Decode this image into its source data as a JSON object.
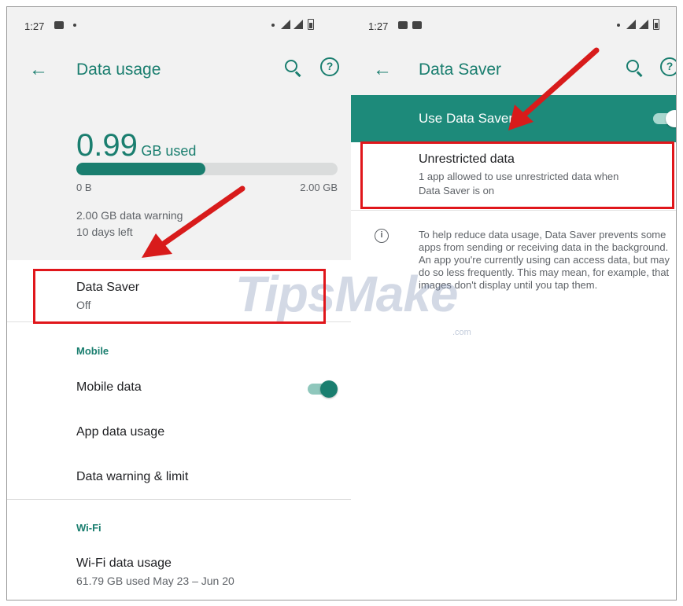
{
  "left": {
    "status": {
      "time": "1:27"
    },
    "appbar": {
      "title": "Data usage",
      "back_icon": "arrow-left-icon",
      "search_icon": "search-icon",
      "help_icon": "help-icon",
      "help_glyph": "?"
    },
    "summary": {
      "used_value": "0.99",
      "used_unit": "GB used",
      "progress_fraction": 0.495,
      "range_min": "0 B",
      "range_max": "2.00 GB",
      "warning": "2.00 GB data warning",
      "days_left": "10 days left"
    },
    "data_saver": {
      "title": "Data Saver",
      "status": "Off"
    },
    "mobile": {
      "section": "Mobile",
      "mobile_data": {
        "label": "Mobile data",
        "enabled": true
      },
      "app_data_usage": "App data usage",
      "warning_limit": "Data warning & limit"
    },
    "wifi": {
      "section": "Wi-Fi",
      "usage_title": "Wi-Fi data usage",
      "usage_detail": "61.79 GB used May 23 – Jun 20"
    }
  },
  "right": {
    "status": {
      "time": "1:27"
    },
    "appbar": {
      "title": "Data Saver",
      "back_icon": "arrow-left-icon",
      "search_icon": "search-icon",
      "help_icon": "help-icon",
      "help_glyph": "?"
    },
    "use_data_saver": {
      "label": "Use Data Saver",
      "enabled": true
    },
    "unrestricted": {
      "title": "Unrestricted data",
      "line1": "1 app allowed to use unrestricted data when",
      "line2": "Data Saver is on"
    },
    "info": {
      "icon": "info-icon",
      "glyph": "i",
      "text": "To help reduce data usage, Data Saver prevents some apps from sending or receiving data in the background. An app you're currently using can access data, but may do so less frequently. This may mean, for example, that images don't display until you tap them."
    }
  },
  "watermark": {
    "main": "TipsMake",
    "sub": ".com"
  },
  "colors": {
    "accent": "#1a7e6f",
    "banner": "#1d8a7a",
    "highlight": "#e0161b"
  }
}
